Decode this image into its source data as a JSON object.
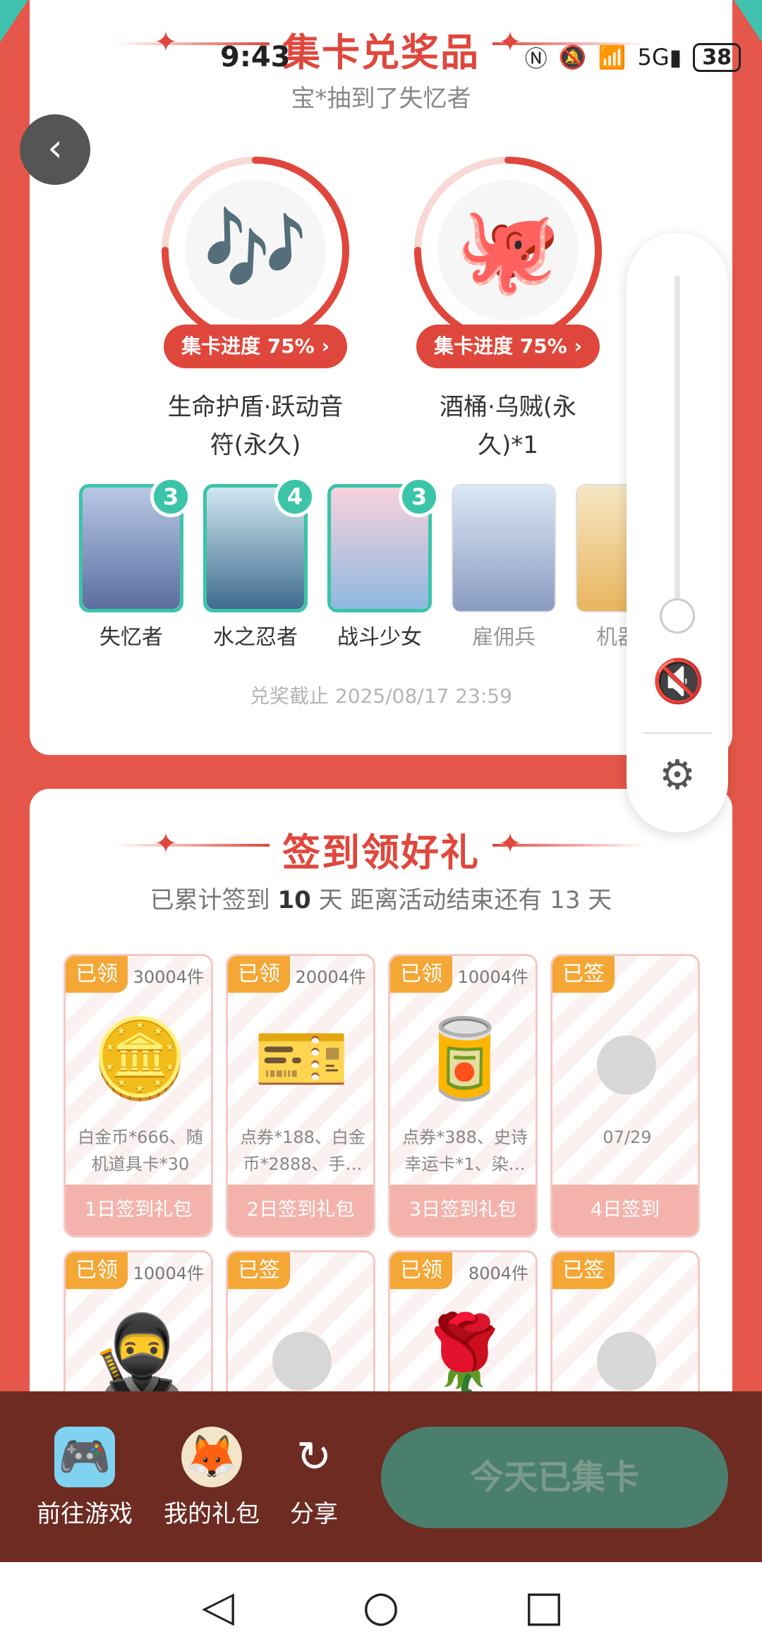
{
  "status": {
    "time": "9:43",
    "battery": "38",
    "icons": [
      "nfc-icon",
      "mute-icon",
      "wifi-icon",
      "5g-signal-icon"
    ]
  },
  "top_section": {
    "title": "集卡兑奖品",
    "winner_msg": "宝*抽到了失忆者",
    "prizes": [
      {
        "icon": "music-notes-icon",
        "glyph": "🎶",
        "progress_label": "集卡进度 75% ›",
        "progress": 0.75,
        "name_line1": "生命护盾·跃动音",
        "name_line2": "符(永久)"
      },
      {
        "icon": "octopus-icon",
        "glyph": "🐙",
        "progress_label": "集卡进度 75% ›",
        "progress": 0.75,
        "name_line1": "酒桶·乌贼(永",
        "name_line2": "久)*1"
      }
    ],
    "characters": [
      {
        "name": "失忆者",
        "count": "3",
        "owned": true
      },
      {
        "name": "水之忍者",
        "count": "4",
        "owned": true
      },
      {
        "name": "战斗少女",
        "count": "3",
        "owned": true
      },
      {
        "name": "雇佣兵",
        "count": "",
        "owned": false
      },
      {
        "name": "机器人",
        "count": "",
        "owned": false
      }
    ],
    "deadline": "兑奖截止 2025/08/17 23:59"
  },
  "signin": {
    "title": "签到领好礼",
    "stats_prefix": "已累计签到 ",
    "stats_days": "10",
    "stats_suffix": " 天  距离活动结束还有 13 天",
    "gifts": [
      {
        "tag": "已领",
        "count": "30004件",
        "glyph": "🪙",
        "desc": "白金币*666、随机道具卡*30",
        "footer": "1日签到礼包"
      },
      {
        "tag": "已领",
        "count": "20004件",
        "glyph": "🎫",
        "desc": "点券*188、白金币*2888、手…",
        "footer": "2日签到礼包"
      },
      {
        "tag": "已领",
        "count": "10004件",
        "glyph": "🥫",
        "desc": "点券*388、史诗幸运卡*1、染…",
        "footer": "3日签到礼包"
      },
      {
        "tag": "已签",
        "count": "",
        "glyph": "",
        "desc": "07/29",
        "footer": "4日签到"
      },
      {
        "tag": "已领",
        "count": "10004件",
        "glyph": "🥷",
        "desc": "",
        "footer": ""
      },
      {
        "tag": "已签",
        "count": "",
        "glyph": "",
        "desc": "",
        "footer": ""
      },
      {
        "tag": "已领",
        "count": "8004件",
        "glyph": "🌹",
        "desc": "",
        "footer": ""
      },
      {
        "tag": "已签",
        "count": "",
        "glyph": "",
        "desc": "",
        "footer": ""
      }
    ]
  },
  "bottom_bar": {
    "go_game": "前往游戏",
    "my_gifts": "我的礼包",
    "share": "分享",
    "main_button": "今天已集卡"
  },
  "colors": {
    "accent": "#e0473c",
    "teal": "#3bc4a8",
    "tag": "#f4a735",
    "bottom_bar": "#6e2b22",
    "main_button": "#4a7f6e"
  }
}
